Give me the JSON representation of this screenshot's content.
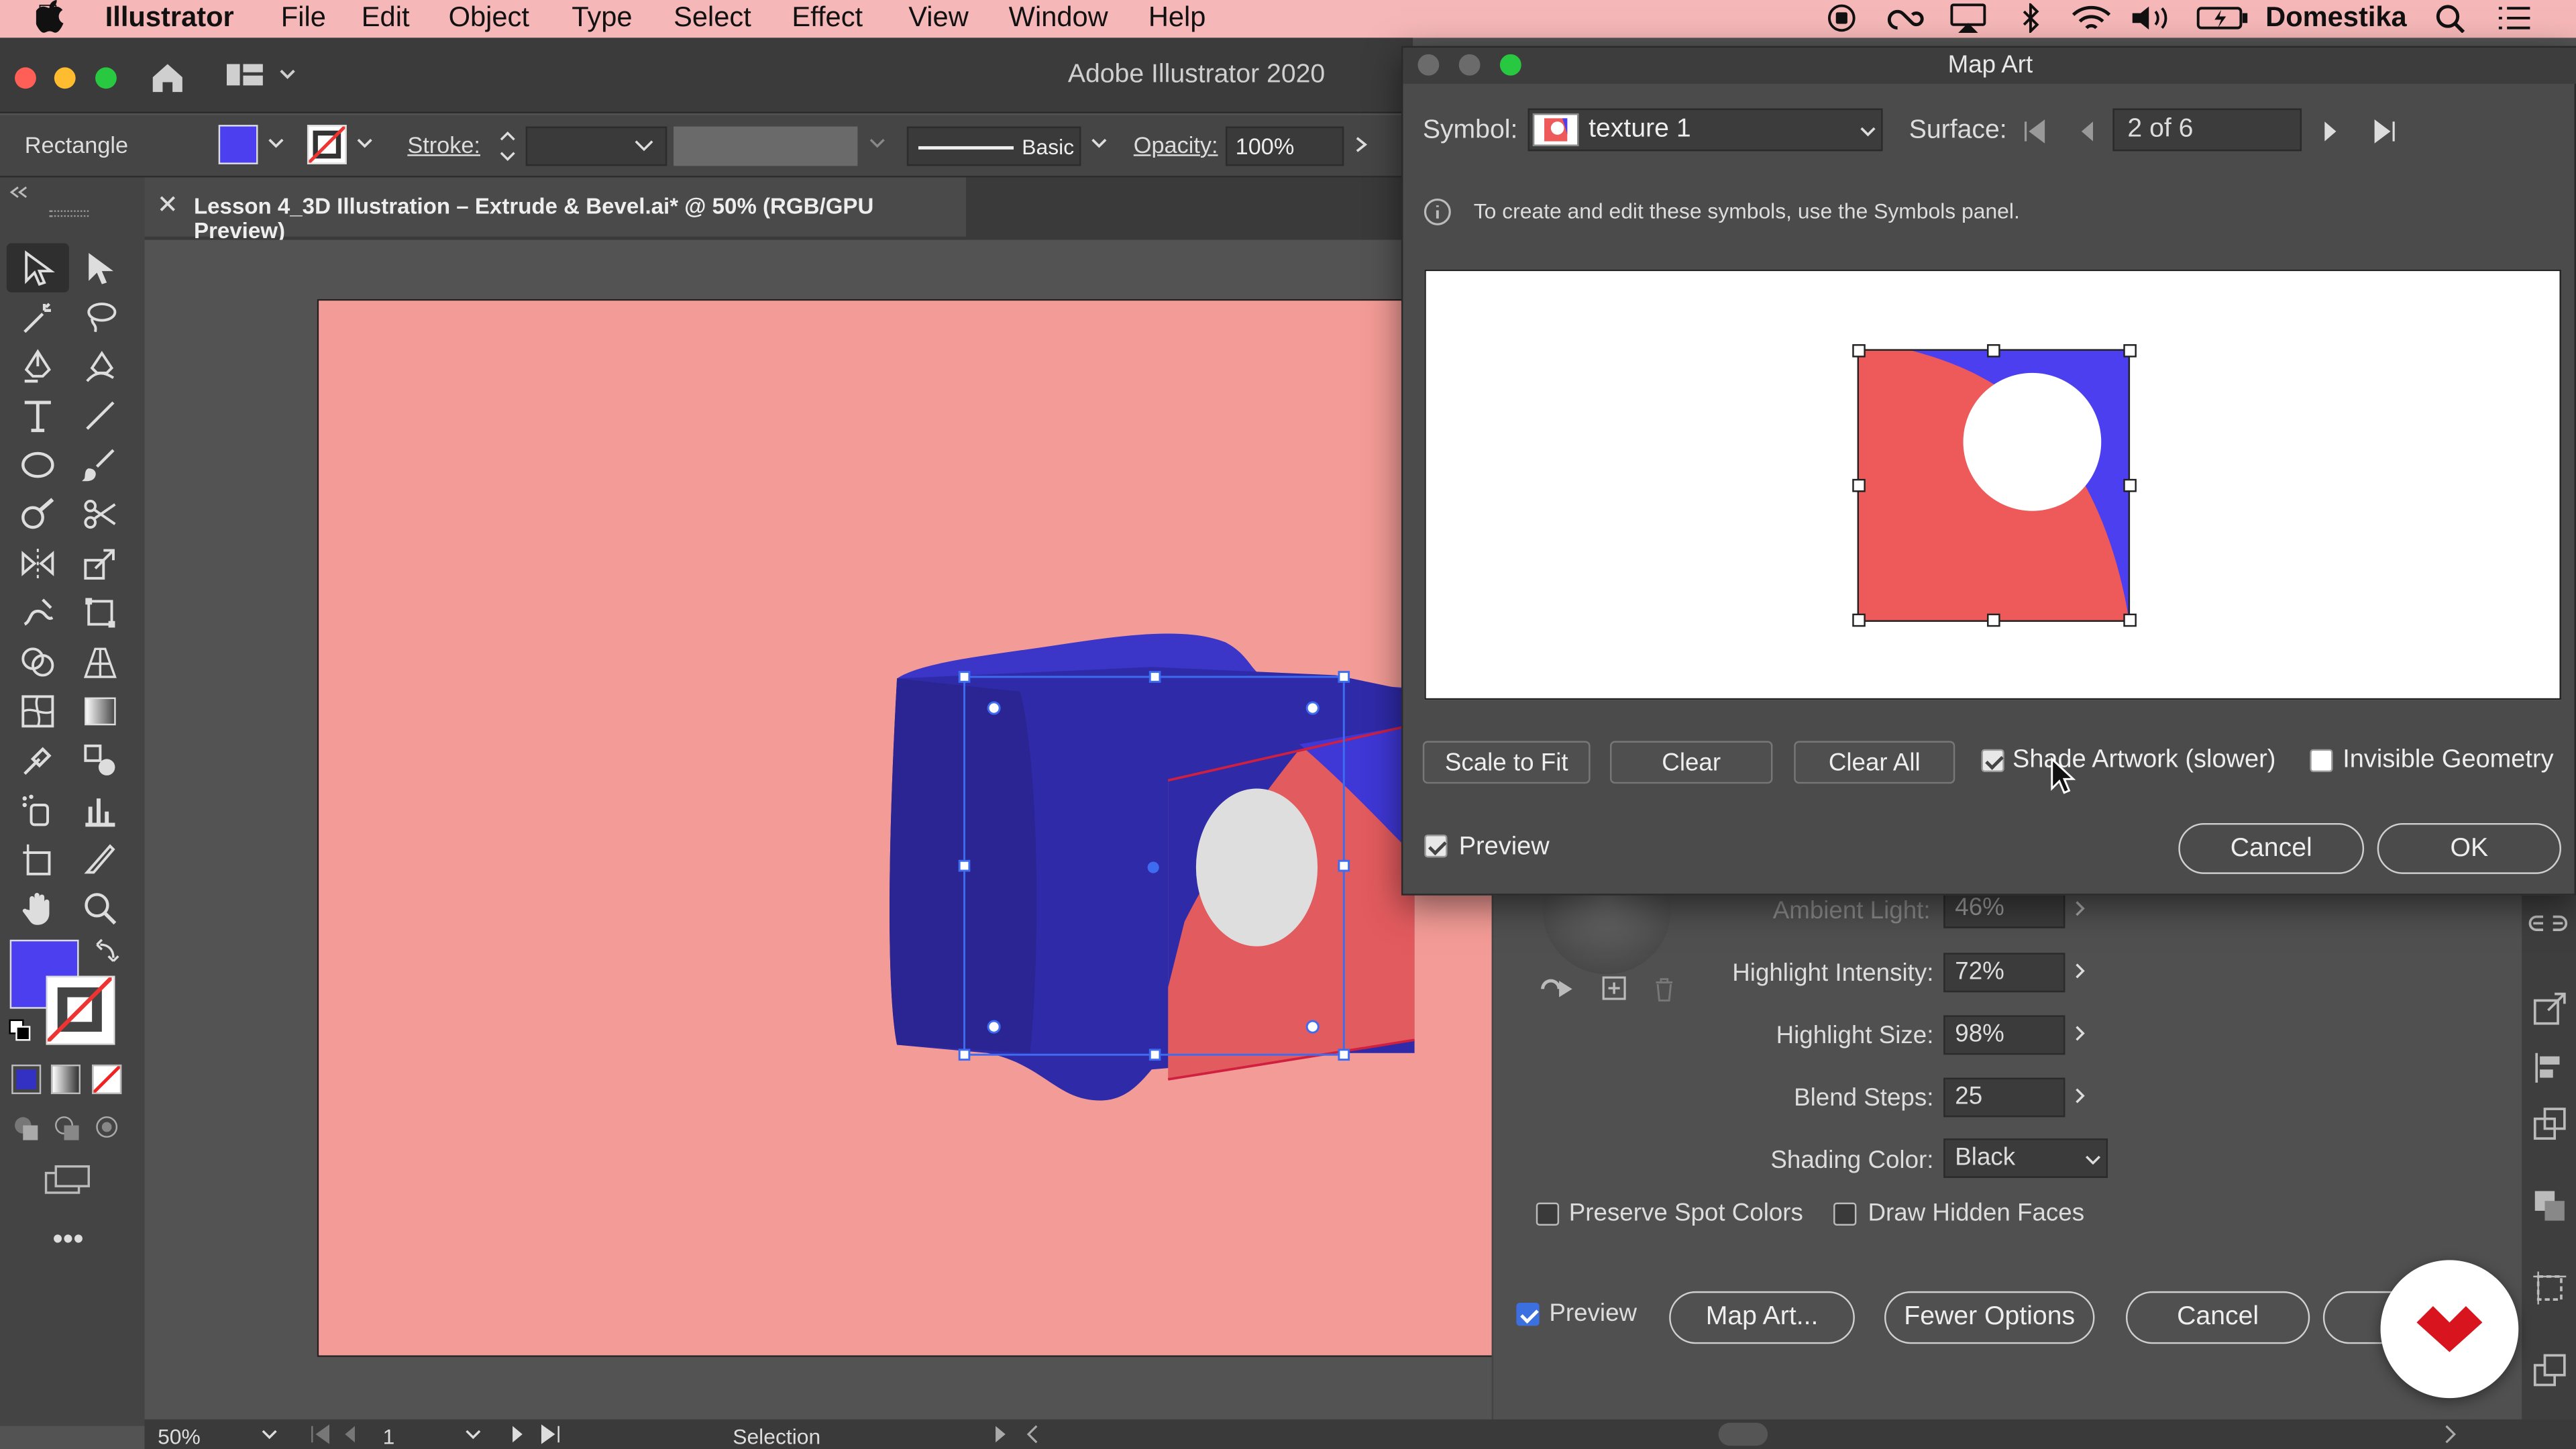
{
  "menubar": {
    "app_name": "Illustrator",
    "items": [
      "File",
      "Edit",
      "Object",
      "Type",
      "Select",
      "Effect",
      "View",
      "Window",
      "Help"
    ],
    "user": "Domestika"
  },
  "app": {
    "title": "Adobe Illustrator 2020"
  },
  "control_bar": {
    "tool_name": "Rectangle",
    "fill_color": "#4b3ff0",
    "stroke_label": "Stroke:",
    "brush_label": "Basic",
    "opacity_label": "Opacity:",
    "opacity_value": "100%"
  },
  "document_tab": {
    "title": "Lesson 4_3D Illustration – Extrude & Bevel.ai* @ 50% (RGB/GPU Preview)"
  },
  "status_bar": {
    "zoom": "50%",
    "artboard_number": "1",
    "tool_status": "Selection"
  },
  "colors": {
    "artboard": "#f39b96",
    "cube_blue": "#2f2aa8",
    "texture_red": "#ee5a5a",
    "texture_blue": "#4b3ff0",
    "menubar": "#f5b7b7",
    "brand_red": "#d8141f"
  },
  "map_art": {
    "title": "Map Art",
    "symbol_label": "Symbol:",
    "symbol_value": "texture 1",
    "surface_label": "Surface:",
    "surface_value": "2 of 6",
    "info_text": "To create and edit these symbols, use the Symbols panel.",
    "scale_to_fit": "Scale to Fit",
    "clear": "Clear",
    "clear_all": "Clear All",
    "shade_artwork": "Shade Artwork (slower)",
    "shade_artwork_checked": true,
    "invisible_geometry": "Invisible Geometry",
    "invisible_geometry_checked": false,
    "preview": "Preview",
    "preview_checked": true,
    "cancel": "Cancel",
    "ok": "OK"
  },
  "extrude_options": {
    "ambient_light_label": "Ambient Light:",
    "ambient_light_value": "46%",
    "highlight_intensity_label": "Highlight Intensity:",
    "highlight_intensity_value": "72%",
    "highlight_size_label": "Highlight Size:",
    "highlight_size_value": "98%",
    "blend_steps_label": "Blend Steps:",
    "blend_steps_value": "25",
    "shading_color_label": "Shading Color:",
    "shading_color_value": "Black",
    "preserve_spot_colors": "Preserve Spot Colors",
    "draw_hidden_faces": "Draw Hidden Faces",
    "preview": "Preview",
    "map_art_button": "Map Art...",
    "fewer_options": "Fewer Options",
    "cancel": "Cancel"
  }
}
